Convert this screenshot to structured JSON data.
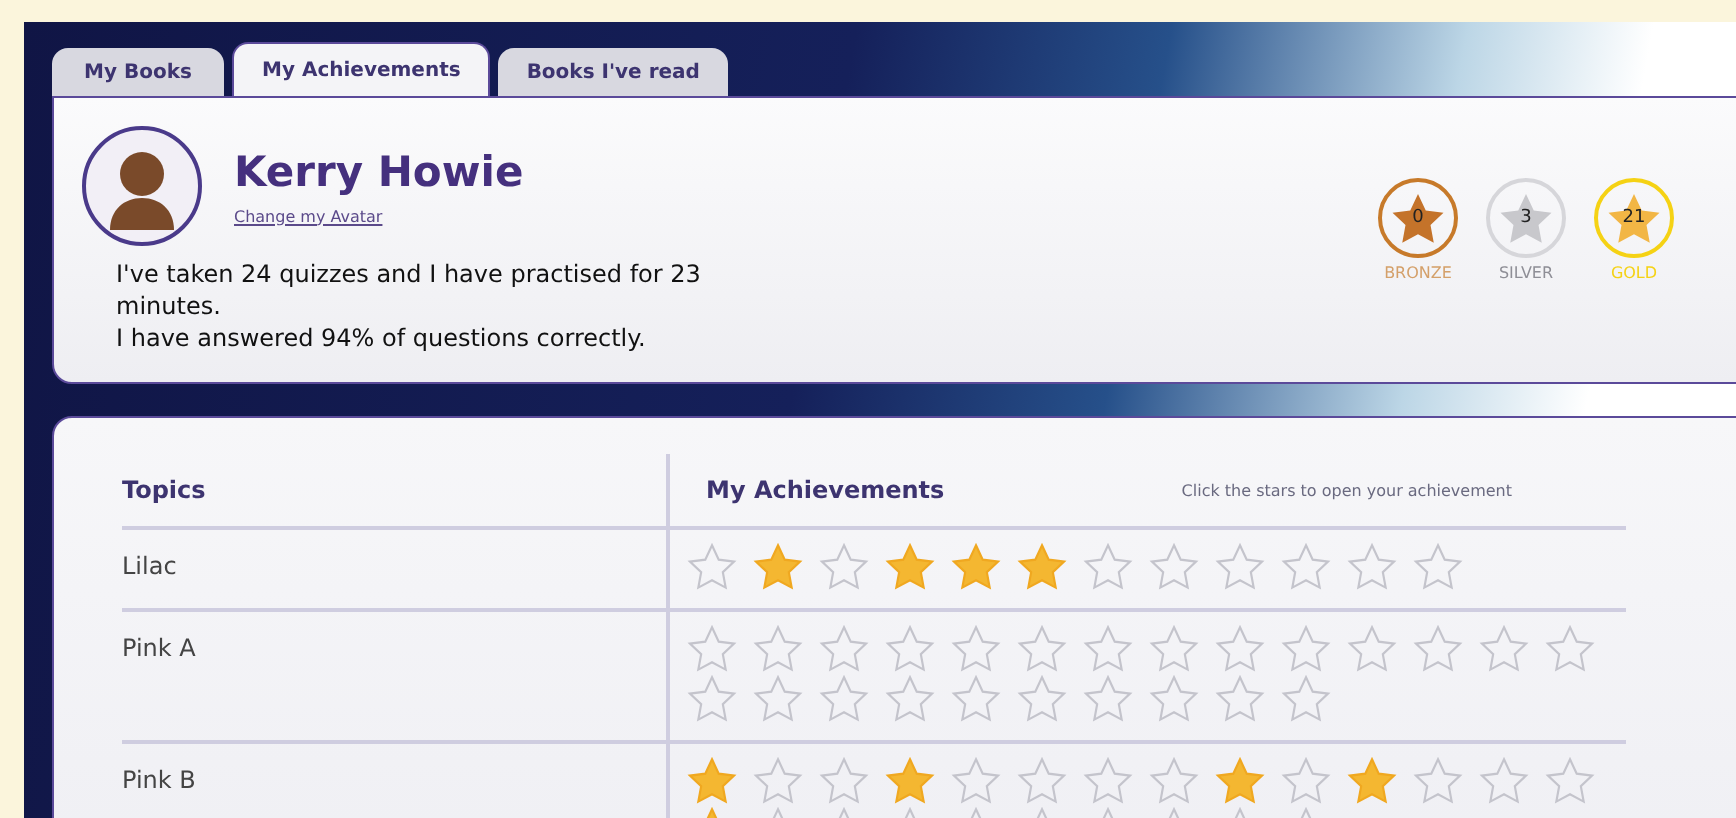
{
  "tabs": [
    {
      "label": "My Books",
      "selected": false
    },
    {
      "label": "My Achievements",
      "selected": true
    },
    {
      "label": "Books I've read",
      "selected": false
    }
  ],
  "profile": {
    "name": "Kerry Howie",
    "avatar_link": "Change my Avatar",
    "summary": [
      "I've taken 24 quizzes and I have practised for 23 minutes.",
      "I have answered 94% of questions correctly."
    ]
  },
  "medals": [
    {
      "kind": "bronze",
      "count": "0",
      "label": "BRONZE"
    },
    {
      "kind": "silver",
      "count": "3",
      "label": "SILVER"
    },
    {
      "kind": "gold",
      "count": "21",
      "label": "GOLD"
    }
  ],
  "table": {
    "columns": [
      "Topics",
      "My Achievements"
    ],
    "hint": "Click the stars to open your achievement",
    "rows": [
      {
        "topic": "Lilac",
        "stars": [
          false,
          true,
          false,
          true,
          true,
          true,
          false,
          false,
          false,
          false,
          false,
          false
        ]
      },
      {
        "topic": "Pink A",
        "stars": [
          false,
          false,
          false,
          false,
          false,
          false,
          false,
          false,
          false,
          false,
          false,
          false,
          false,
          false,
          false,
          false,
          false,
          false,
          false,
          false,
          false,
          false,
          false,
          false
        ]
      },
      {
        "topic": "Pink B",
        "stars": [
          true,
          false,
          false,
          true,
          false,
          false,
          false,
          false,
          true,
          false,
          true,
          false,
          false,
          false,
          true,
          false,
          false,
          false,
          false,
          false,
          false,
          false,
          false,
          false
        ]
      }
    ]
  }
}
